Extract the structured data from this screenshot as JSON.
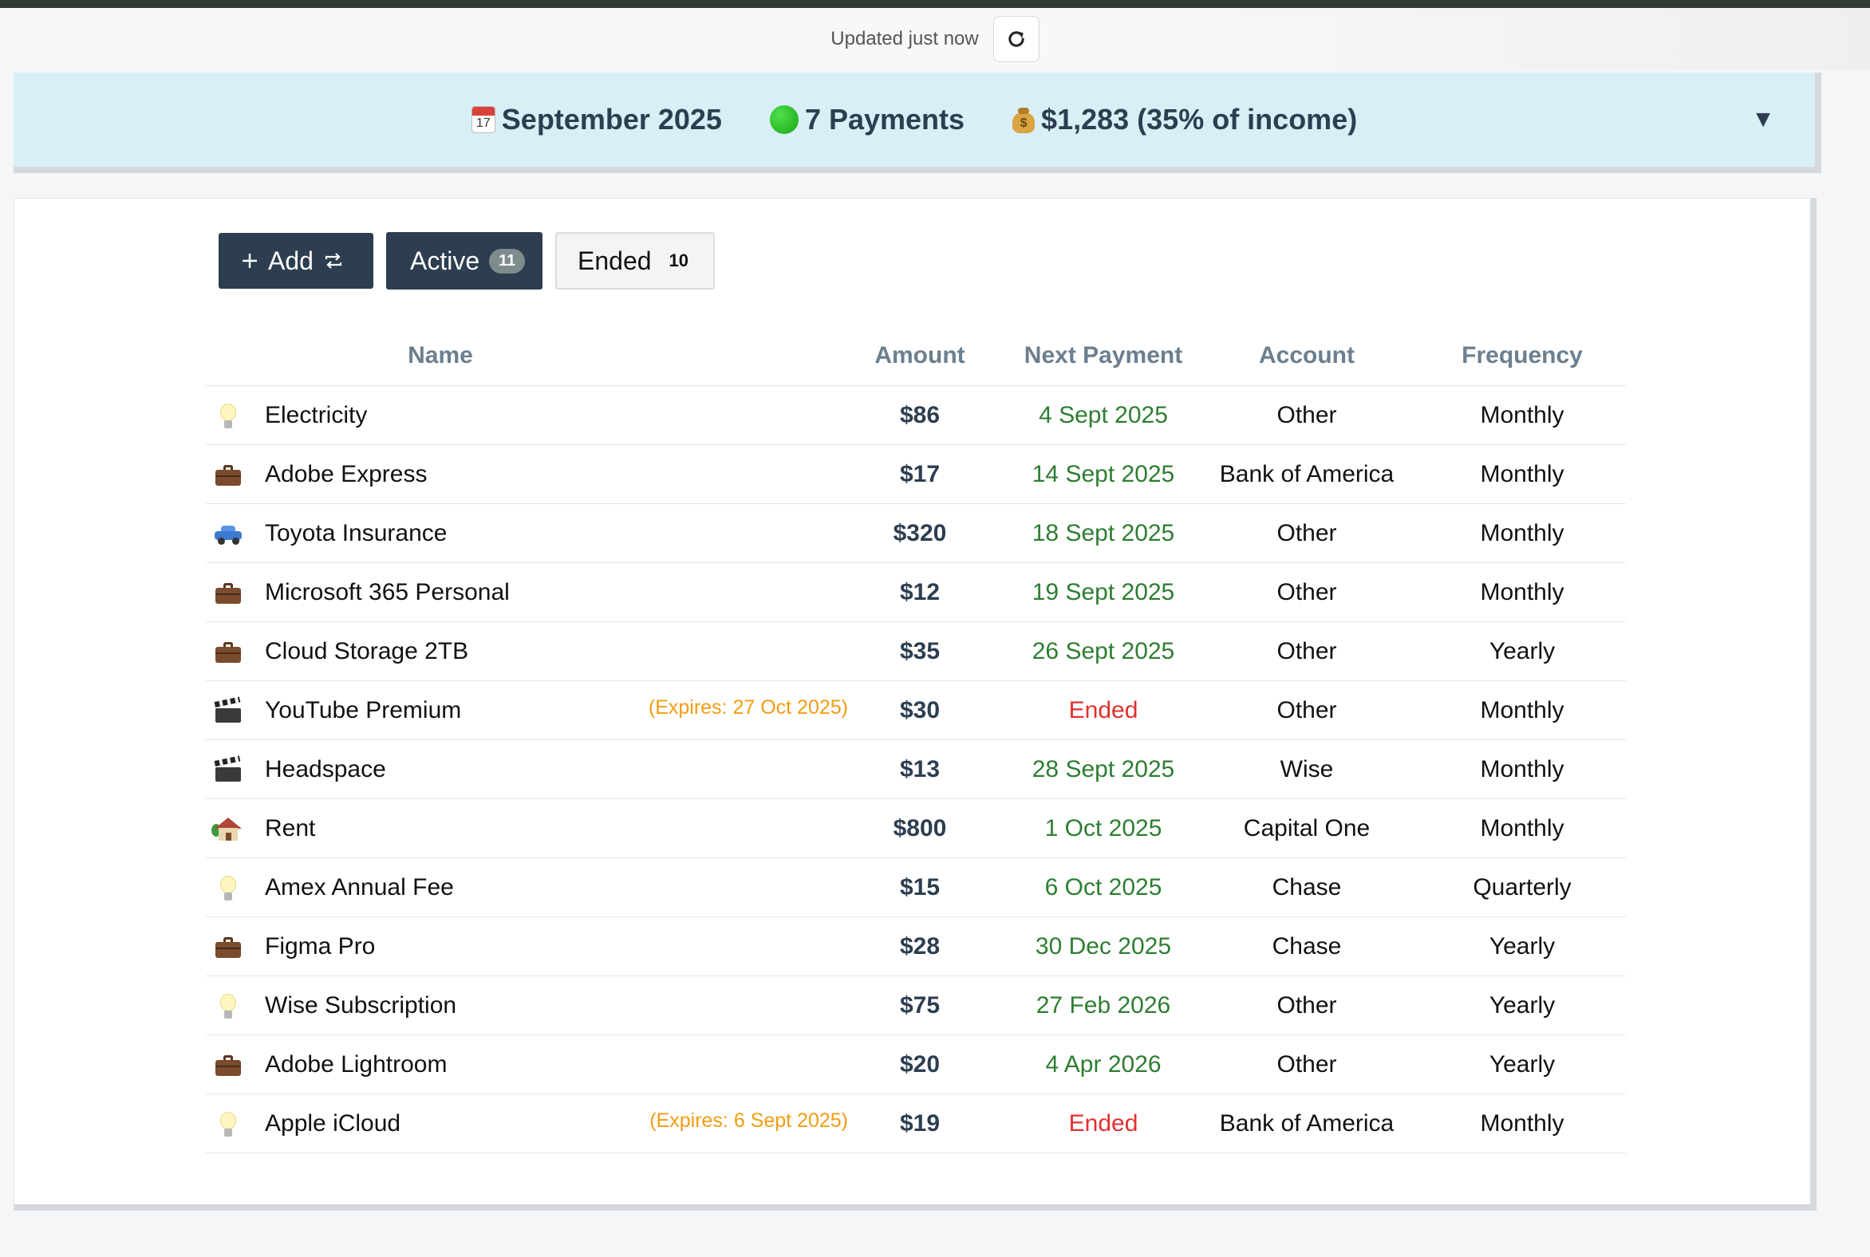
{
  "status": {
    "updated_text": "Updated just now"
  },
  "summary": {
    "calendar_day": "17",
    "month": "September 2025",
    "payments": "7 Payments",
    "total": "$1,283 (35% of income)"
  },
  "controls": {
    "add_label": "Add",
    "active_label": "Active",
    "active_count": "11",
    "ended_label": "Ended",
    "ended_count": "10"
  },
  "table": {
    "headers": {
      "name": "Name",
      "amount": "Amount",
      "next_payment": "Next Payment",
      "account": "Account",
      "frequency": "Frequency"
    },
    "rows": [
      {
        "icon": "lightbulb-icon",
        "name": "Electricity",
        "expires": "",
        "amount": "$86",
        "next_payment": "4 Sept 2025",
        "ended": false,
        "account": "Other",
        "frequency": "Monthly"
      },
      {
        "icon": "briefcase-icon",
        "name": "Adobe Express",
        "expires": "",
        "amount": "$17",
        "next_payment": "14 Sept 2025",
        "ended": false,
        "account": "Bank of America",
        "frequency": "Monthly"
      },
      {
        "icon": "car-icon",
        "name": "Toyota Insurance",
        "expires": "",
        "amount": "$320",
        "next_payment": "18 Sept 2025",
        "ended": false,
        "account": "Other",
        "frequency": "Monthly"
      },
      {
        "icon": "briefcase-icon",
        "name": "Microsoft 365 Personal",
        "expires": "",
        "amount": "$12",
        "next_payment": "19 Sept 2025",
        "ended": false,
        "account": "Other",
        "frequency": "Monthly"
      },
      {
        "icon": "briefcase-icon",
        "name": "Cloud Storage 2TB",
        "expires": "",
        "amount": "$35",
        "next_payment": "26 Sept 2025",
        "ended": false,
        "account": "Other",
        "frequency": "Yearly"
      },
      {
        "icon": "clapperboard-icon",
        "name": "YouTube Premium",
        "expires": "(Expires: 27 Oct 2025)",
        "amount": "$30",
        "next_payment": "Ended",
        "ended": true,
        "account": "Other",
        "frequency": "Monthly"
      },
      {
        "icon": "clapperboard-icon",
        "name": "Headspace",
        "expires": "",
        "amount": "$13",
        "next_payment": "28 Sept 2025",
        "ended": false,
        "account": "Wise",
        "frequency": "Monthly"
      },
      {
        "icon": "house-icon",
        "name": "Rent",
        "expires": "",
        "amount": "$800",
        "next_payment": "1 Oct 2025",
        "ended": false,
        "account": "Capital One",
        "frequency": "Monthly"
      },
      {
        "icon": "lightbulb-icon",
        "name": "Amex Annual Fee",
        "expires": "",
        "amount": "$15",
        "next_payment": "6 Oct 2025",
        "ended": false,
        "account": "Chase",
        "frequency": "Quarterly"
      },
      {
        "icon": "briefcase-icon",
        "name": "Figma Pro",
        "expires": "",
        "amount": "$28",
        "next_payment": "30 Dec 2025",
        "ended": false,
        "account": "Chase",
        "frequency": "Yearly"
      },
      {
        "icon": "lightbulb-icon",
        "name": "Wise Subscription",
        "expires": "",
        "amount": "$75",
        "next_payment": "27 Feb 2026",
        "ended": false,
        "account": "Other",
        "frequency": "Yearly"
      },
      {
        "icon": "briefcase-icon",
        "name": "Adobe Lightroom",
        "expires": "",
        "amount": "$20",
        "next_payment": "4 Apr 2026",
        "ended": false,
        "account": "Other",
        "frequency": "Yearly"
      },
      {
        "icon": "lightbulb-icon",
        "name": "Apple iCloud",
        "expires": "(Expires: 6 Sept 2025)",
        "amount": "$19",
        "next_payment": "Ended",
        "ended": true,
        "account": "Bank of America",
        "frequency": "Monthly"
      }
    ]
  },
  "colors": {
    "primary": "#2c3e50",
    "summary_bg": "#d9eff6",
    "next_payment_green": "#2e7d32",
    "ended_red": "#e03030",
    "expires_orange": "#f39c12"
  }
}
